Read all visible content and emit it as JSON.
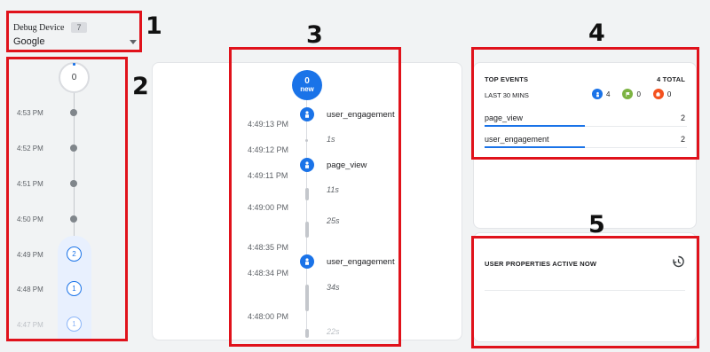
{
  "callouts": [
    "1",
    "2",
    "3",
    "4",
    "5"
  ],
  "debug_device": {
    "label": "Debug Device",
    "count": "7",
    "selected": "Google"
  },
  "minutes": {
    "top_count": "0",
    "rows": [
      {
        "time": "4:53 PM",
        "count": null
      },
      {
        "time": "4:52 PM",
        "count": null
      },
      {
        "time": "4:51 PM",
        "count": null
      },
      {
        "time": "4:50 PM",
        "count": null
      },
      {
        "time": "4:49 PM",
        "count": "2"
      },
      {
        "time": "4:48 PM",
        "count": "1"
      },
      {
        "time": "4:47 PM",
        "count": "1"
      }
    ]
  },
  "seconds": {
    "new_count": "0",
    "new_label": "new",
    "timestamps": [
      "4:49:13 PM",
      "4:49:12 PM",
      "4:49:11 PM",
      "4:49:00 PM",
      "4:48:35 PM",
      "4:48:34 PM",
      "4:48:00 PM"
    ],
    "events": [
      "user_engagement",
      "page_view",
      "user_engagement"
    ],
    "gaps": [
      "1s",
      "11s",
      "25s",
      "34s",
      "22s"
    ]
  },
  "top_events": {
    "title": "TOP EVENTS",
    "total": "4 TOTAL",
    "period": "LAST 30 MINS",
    "stats": [
      {
        "icon": "event-icon",
        "color": "#1a73e8",
        "value": "4"
      },
      {
        "icon": "conversion-flag-icon",
        "color": "#7cb342",
        "value": "0"
      },
      {
        "icon": "error-icon",
        "color": "#f4511e",
        "value": "0"
      }
    ],
    "rows": [
      {
        "name": "page_view",
        "value": "2"
      },
      {
        "name": "user_engagement",
        "value": "2"
      }
    ]
  },
  "user_properties": {
    "title": "USER PROPERTIES ACTIVE NOW"
  }
}
